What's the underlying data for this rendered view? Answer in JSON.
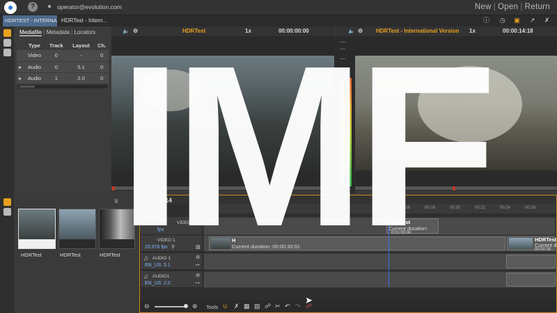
{
  "topbar": {
    "user_email": "operator@evolution.com",
    "actions": [
      "New",
      "Open",
      "Return"
    ],
    "help_icon": "?"
  },
  "tabs": {
    "tab1": "HDRTEST - INTERNA...",
    "tab2": "HDRTest - Intern..."
  },
  "mediafile": {
    "tabs": [
      "Mediafile",
      "Metadata",
      "Locators"
    ],
    "columns": [
      "Type",
      "Track",
      "Layout",
      "Ch."
    ],
    "rows": [
      {
        "expand": "",
        "type": "Video",
        "track": "0",
        "layout": "-",
        "ch": "0"
      },
      {
        "expand": "▸",
        "type": "Audio",
        "track": "0",
        "layout": "5.1",
        "ch": "0"
      },
      {
        "expand": "▸",
        "type": "Audio",
        "track": "1",
        "layout": "2.0",
        "ch": "0"
      }
    ]
  },
  "viewer_left": {
    "title": "HDRTest",
    "speed": "1x",
    "timecode": "00:00:00:00"
  },
  "viewer_right": {
    "title": "HDRTest - International Version",
    "speed": "1x",
    "timecode": "00:00:14:18"
  },
  "bins": {
    "thumbnails": [
      {
        "label": "HDRTest"
      },
      {
        "label": "HDRTest"
      },
      {
        "label": "HDRTest"
      }
    ]
  },
  "timeline": {
    "timecode_partial": "00:14",
    "ruler": [
      "00:16",
      "00:18",
      "00:20",
      "00:22",
      "00:24",
      "00:26"
    ],
    "tracks": [
      {
        "name": "VIDEO 2",
        "fps": "fps"
      },
      {
        "name": "VIDEO 1",
        "fps": "23.976 fps"
      },
      {
        "name": "AUDIO 1",
        "lang": "EN_US",
        "layout": "5.1"
      },
      {
        "name": "AUDIO1",
        "lang": "EN_US",
        "layout": "2.0"
      }
    ],
    "clips": {
      "v2_title": "HDRTest",
      "v2_sub": "Current duration:",
      "v2_sub2": "0:01:00:00",
      "v1_title": "H",
      "v1_sub": "Current duration: 00:00:30:01",
      "v1b_title": "HDRTest",
      "v1b_sub": "Current d",
      "v1b_sub2": "00:00:30"
    },
    "tools_label": "Tools"
  },
  "overlay": {
    "text": "IMF"
  },
  "colors": {
    "accent_orange": "#e8a020",
    "tab_blue": "#4d6a8c",
    "playhead": "#3c6cf0"
  }
}
